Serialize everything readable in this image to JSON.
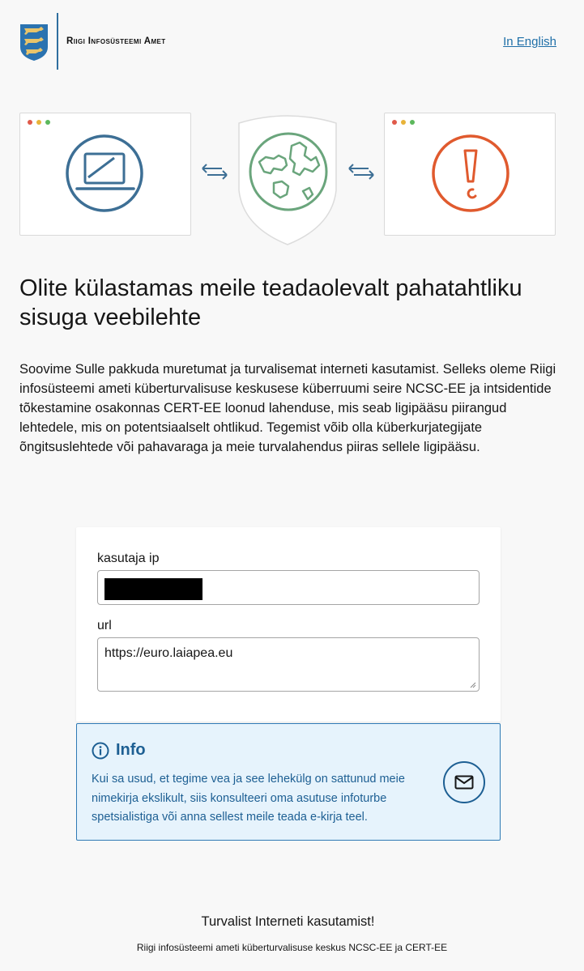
{
  "header": {
    "org_name": "Riigi Infosüsteemi Amet",
    "language_link": "In English"
  },
  "page": {
    "title": "Olite külastamas meile teadaolevalt pahatahtliku sisuga veebilehte",
    "intro": "Soovime Sulle pakkuda muretumat ja turvalisemat interneti kasutamist. Selleks oleme Riigi infosüsteemi ameti küberturvalisuse keskusese küberruumi seire NCSC-EE ja intsidentide tõkestamine osakonnas CERT-EE loonud lahenduse, mis seab ligipääsu piirangud lehtedele, mis on potentsiaalselt ohtlikud. Tegemist võib olla küberkurjategijate õngitsuslehtede või pahavaraga ja meie turvalahendus piiras sellele ligipääsu."
  },
  "form": {
    "ip_label": "kasutaja ip",
    "ip_value": "",
    "url_label": "url",
    "url_value": "https://euro.laiapea.eu"
  },
  "info": {
    "title": "Info",
    "text": "Kui sa usud, et tegime vea ja see lehekülg on sattunud meie nimekirja ekslikult, siis konsulteeri oma asutuse infoturbe spetsialistiga või anna sellest meile teada e-kirja teel."
  },
  "footer": {
    "main": "Turvalist Interneti kasutamist!",
    "sub": "Riigi infosüsteemi ameti küberturvalisuse keskus NCSC-EE ja CERT-EE"
  },
  "colors": {
    "accent_blue": "#1d5f93",
    "laptop_blue": "#3d6f95",
    "globe_green": "#6aa57c",
    "alert_orange": "#e05a2e",
    "info_bg": "#e6f3fc"
  },
  "icons": {
    "crest": "estonian-coat-of-arms-icon",
    "laptop": "laptop-icon",
    "globe": "globe-icon",
    "alert": "exclamation-icon",
    "arrows": "bidirectional-arrows-icon",
    "info": "info-circle-icon",
    "mail": "envelope-icon"
  }
}
